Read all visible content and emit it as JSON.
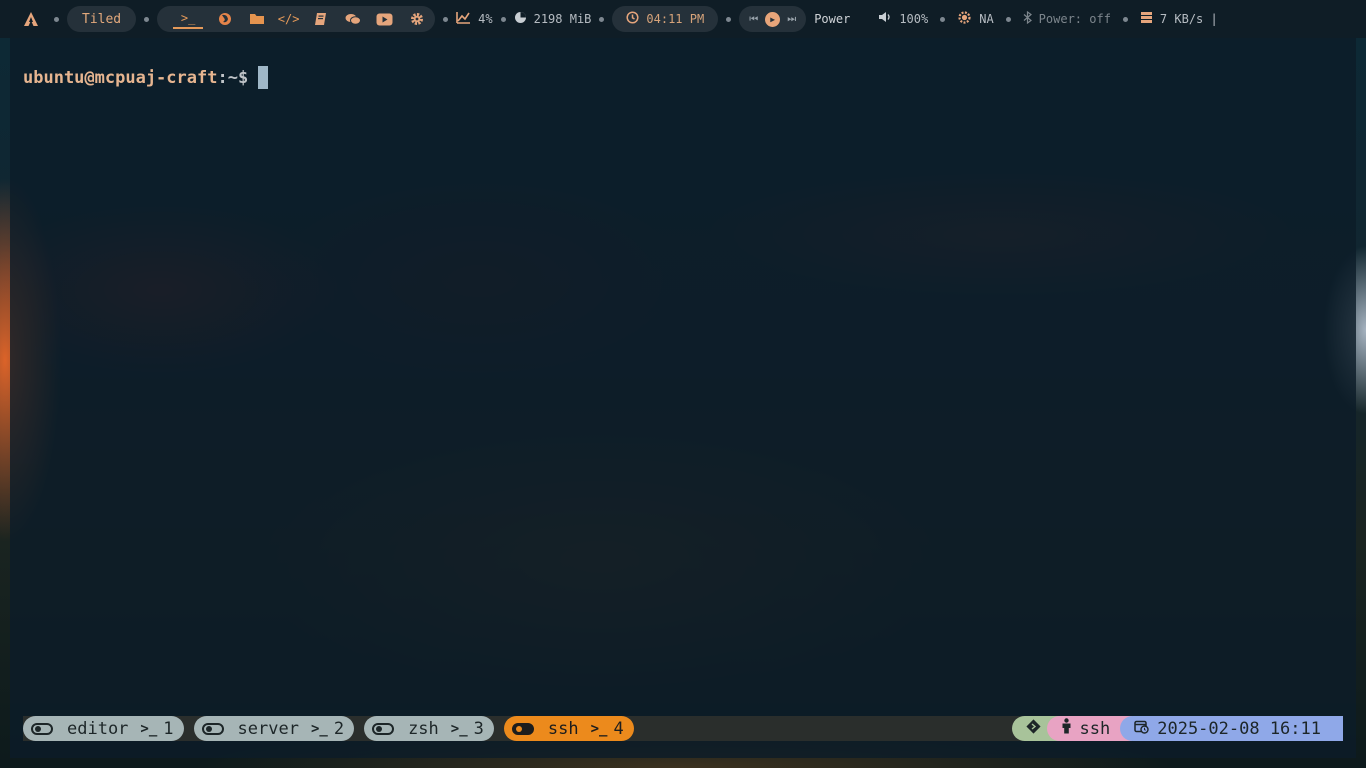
{
  "topbar": {
    "layout_label": "Tiled",
    "apps": [
      {
        "name": "terminal-icon",
        "glyph": ">_"
      },
      {
        "name": "firefox-icon",
        "glyph": "◉"
      },
      {
        "name": "folder-icon",
        "glyph": "▰"
      },
      {
        "name": "code-editor-icon",
        "glyph": "</>"
      },
      {
        "name": "notes-icon",
        "glyph": "▤"
      },
      {
        "name": "chat-icon",
        "glyph": "◖"
      },
      {
        "name": "youtube-icon",
        "glyph": "▶"
      },
      {
        "name": "settings-icon",
        "glyph": "✲"
      }
    ],
    "cpu": "4%",
    "memory": "2198 MiB",
    "clock": "04:11 PM",
    "power_label": "Power",
    "volume": "100%",
    "brightness": "NA",
    "bluetooth": "Power: off",
    "network": "7 KB/s |"
  },
  "terminal": {
    "user_host": "ubuntu@mcpuaj-craft",
    "path": ":~$"
  },
  "statusbar": {
    "windows": [
      {
        "label": "editor",
        "index": "1",
        "active": false
      },
      {
        "label": "server",
        "index": "2",
        "active": false
      },
      {
        "label": "zsh",
        "index": "3",
        "active": false
      },
      {
        "label": "ssh",
        "index": "4",
        "active": true
      }
    ],
    "session": "ssh",
    "datetime": "2025-02-08 16:11"
  },
  "colors": {
    "accent_orange": "#ec8a1c",
    "git_green": "#a8c39a",
    "host_pink": "#e8a3c3",
    "date_blue": "#8fa8e8",
    "inactive_tab": "#a6b5b6"
  }
}
